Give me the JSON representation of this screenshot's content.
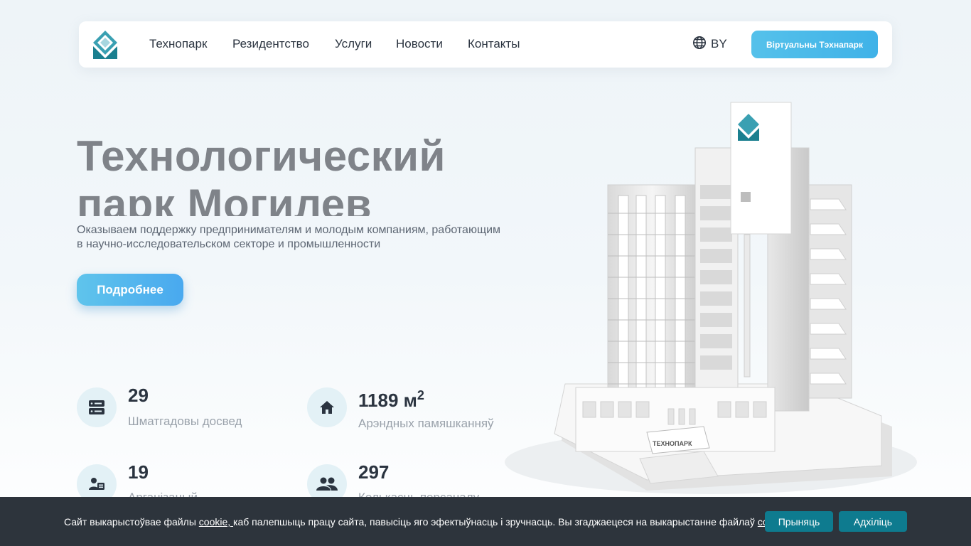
{
  "colors": {
    "accent": "#3fb2e8",
    "cookie_bg": "#2d343c",
    "cookie_button": "#0e7b8f",
    "logo_teal": "#1a7f8f"
  },
  "nav": {
    "items": [
      {
        "label": "Технопарк"
      },
      {
        "label": "Резидентство"
      },
      {
        "label": "Услуги"
      },
      {
        "label": "Новости"
      },
      {
        "label": "Контакты"
      }
    ],
    "language": "BY",
    "language_icon": "globe-icon",
    "virtual_button": "Віртуальны Тэхнапарк"
  },
  "hero": {
    "title_line1": "Технологический",
    "title_line2": "парк Могилев",
    "subtitle_line1": "Оказываем поддержку предпринимателям и молодым компаниям, работающим",
    "subtitle_line2": "в научно-исследовательском секторе и промышленности",
    "more_button": "Подробнее"
  },
  "stats": [
    {
      "value": "29",
      "label": "Шматгадовы досвед",
      "icon": "server-icon"
    },
    {
      "value": "1189 м",
      "sup": "2",
      "label": "Арэндных памяшканняў",
      "icon": "home-icon"
    },
    {
      "value": "19",
      "label": "Арганізацый",
      "icon": "organization-icon"
    },
    {
      "value": "297",
      "label": "Колькасць персаналу",
      "icon": "people-icon"
    }
  ],
  "building": {
    "sign": "ТЕХНОПАРК"
  },
  "cookie": {
    "text1": "Сайт выкарыстоўвае файлы ",
    "link1": "cookie, ",
    "text2": "каб палепшыць працу сайта, павысіць яго эфектыўнасць і зручнасць. Вы згаджаецеся на выкарыстанне файлаў ",
    "link2": "cookie.",
    "accept": "Прыняць",
    "decline": "Адхіліць"
  }
}
